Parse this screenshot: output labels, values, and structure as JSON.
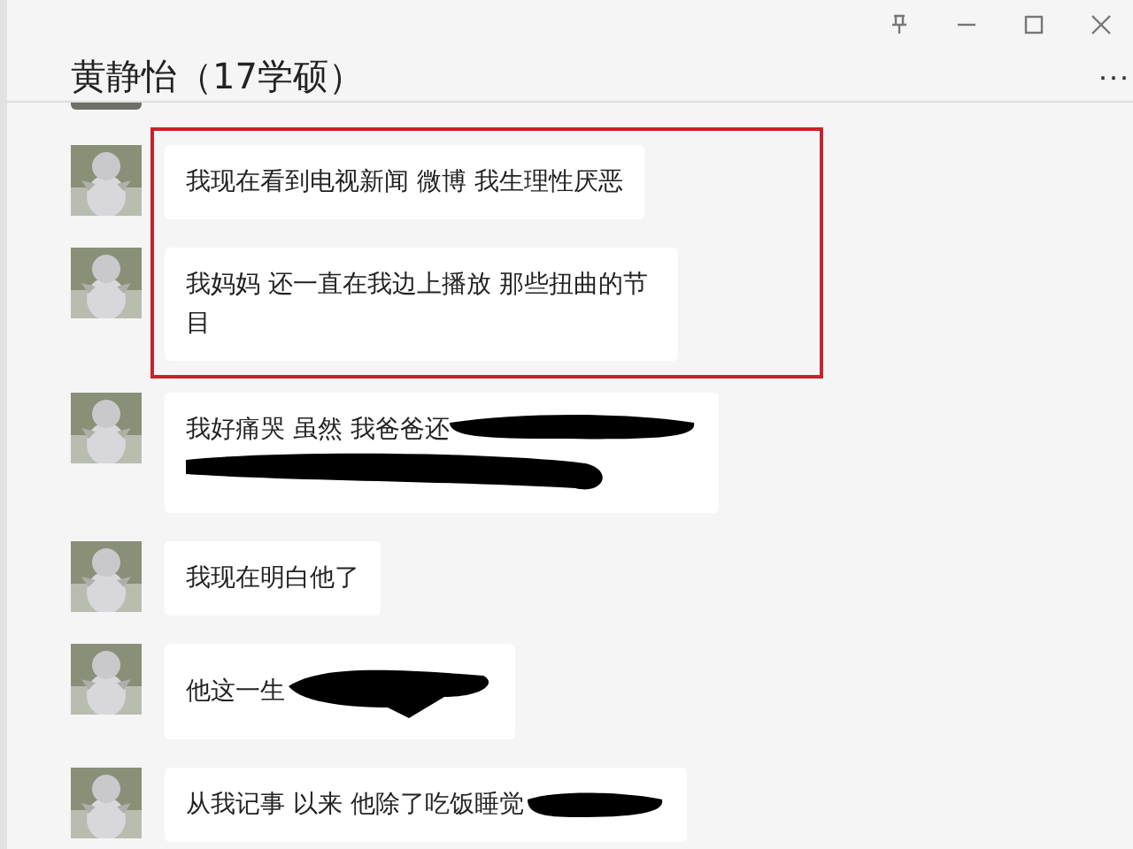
{
  "window": {
    "title": "黄静怡（17学硕）",
    "more": "···"
  },
  "messages": [
    {
      "text": "我现在看到电视新闻 微博 我生理性厌恶",
      "highlighted": true,
      "kind": "plain"
    },
    {
      "text": "我妈妈 还一直在我边上播放 那些扭曲的节目",
      "highlighted": true,
      "kind": "plain"
    },
    {
      "text": "我好痛哭  虽然 我爸爸还",
      "highlighted": false,
      "kind": "redacted_two_line"
    },
    {
      "text": "我现在明白他了",
      "highlighted": false,
      "kind": "plain"
    },
    {
      "text": "他这一生",
      "highlighted": false,
      "kind": "redacted_inline"
    },
    {
      "text": "从我记事 以来  他除了吃饭睡觉",
      "highlighted": false,
      "kind": "redacted_short"
    }
  ]
}
